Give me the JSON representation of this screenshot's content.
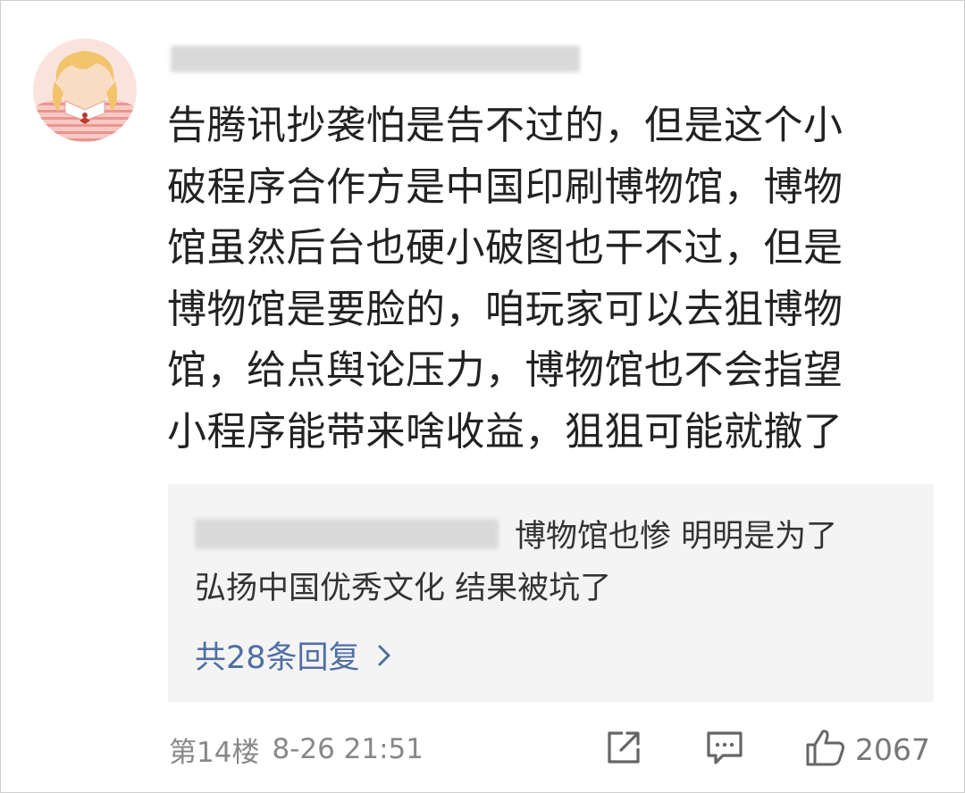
{
  "comment": {
    "lines": [
      "告腾讯抄袭怕是告不过的，但是这个小",
      "破程序合作方是中国印刷博物馆，博物",
      "馆虽然后台也硬小破图也干不过，但是",
      "博物馆是要脸的，咱玩家可以去狙博物",
      "馆，给点舆论压力，博物馆也不会指望",
      "小程序能带来啥收益，狙狙可能就撤了"
    ]
  },
  "reply": {
    "line1": "博物馆也惨 明明是为了",
    "line2": "弘扬中国优秀文化 结果被坑了",
    "more_label": "共28条回复"
  },
  "meta": {
    "floor": "第14楼",
    "time": "8-26 21:51",
    "like_count": "2067"
  },
  "icons": {
    "share": "share-icon",
    "comment": "comment-icon",
    "like": "thumbs-up-icon",
    "more": "chevron-right-icon"
  },
  "colors": {
    "text": "#222222",
    "link": "#4f6fa3",
    "muted": "#888888",
    "reply_bg": "#f4f4f4"
  }
}
